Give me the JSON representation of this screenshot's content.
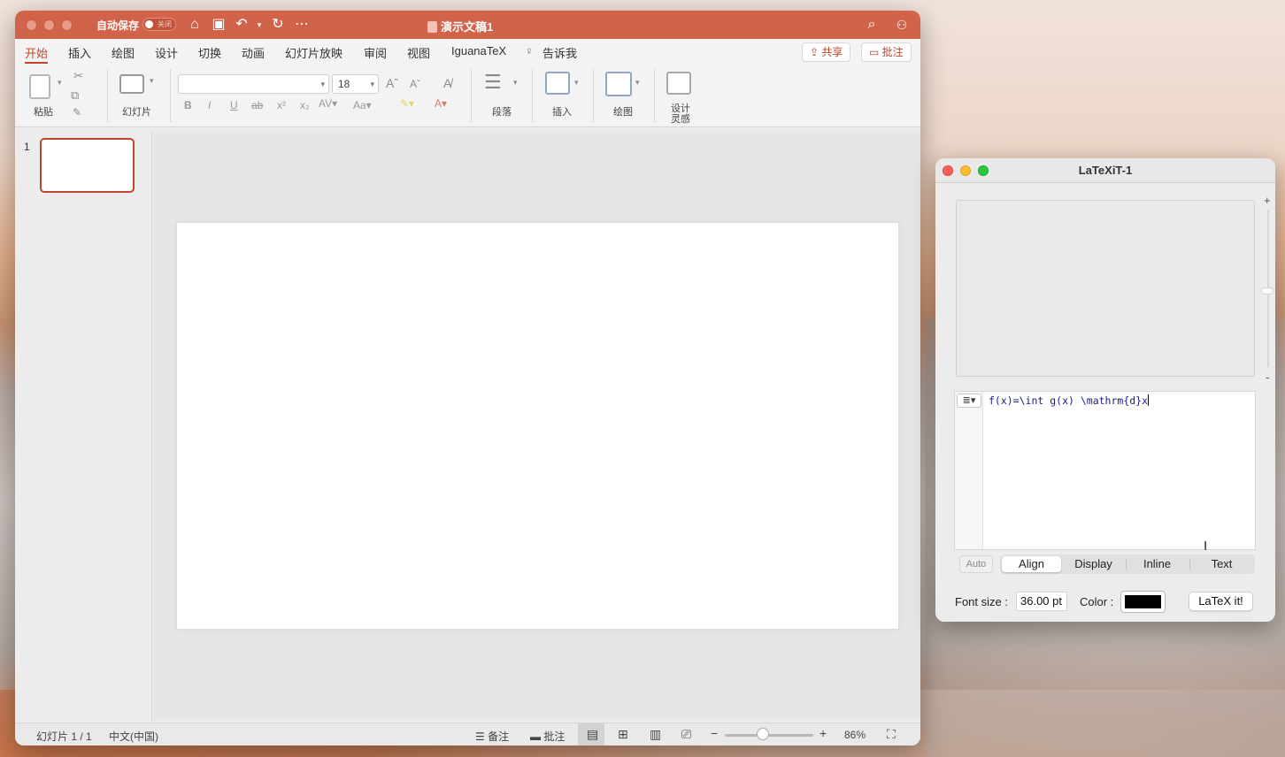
{
  "ppt": {
    "autosave_label": "自动保存",
    "autosave_state": "关闭",
    "doc_title": "演示文稿1",
    "tabs": [
      "开始",
      "插入",
      "绘图",
      "设计",
      "切换",
      "动画",
      "幻灯片放映",
      "审阅",
      "视图",
      "IguanaTeX",
      "告诉我"
    ],
    "active_tab": "开始",
    "share_label": "共享",
    "comment_label": "批注",
    "ribbon": {
      "paste_label": "粘贴",
      "slides_label": "幻灯片",
      "font_name": "",
      "font_size": "18",
      "paragraph_label": "段落",
      "insert_label": "插入",
      "draw_label": "绘图",
      "designer_label": "设计\n灵感"
    },
    "slide_number": "1",
    "status": {
      "slide_count": "幻灯片 1 / 1",
      "language": "中文(中国)",
      "notes_label": "备注",
      "comments_label": "批注",
      "zoom": "86%"
    },
    "colors": {
      "titlebar": "#d2634b",
      "accent": "#c0452d"
    }
  },
  "latexit": {
    "title": "LaTeXiT-1",
    "zoom_plus": "+",
    "zoom_minus": "-",
    "code": "f(x)=\\int g(x) \\mathrm{d}x",
    "mode_auto": "Auto",
    "modes": [
      "Align",
      "Display",
      "Inline",
      "Text"
    ],
    "selected_mode": "Align",
    "font_size_label": "Font size :",
    "font_size_value": "36.00 pt",
    "color_label": "Color :",
    "color_value": "#000000",
    "latex_button": "LaTeX it!"
  }
}
